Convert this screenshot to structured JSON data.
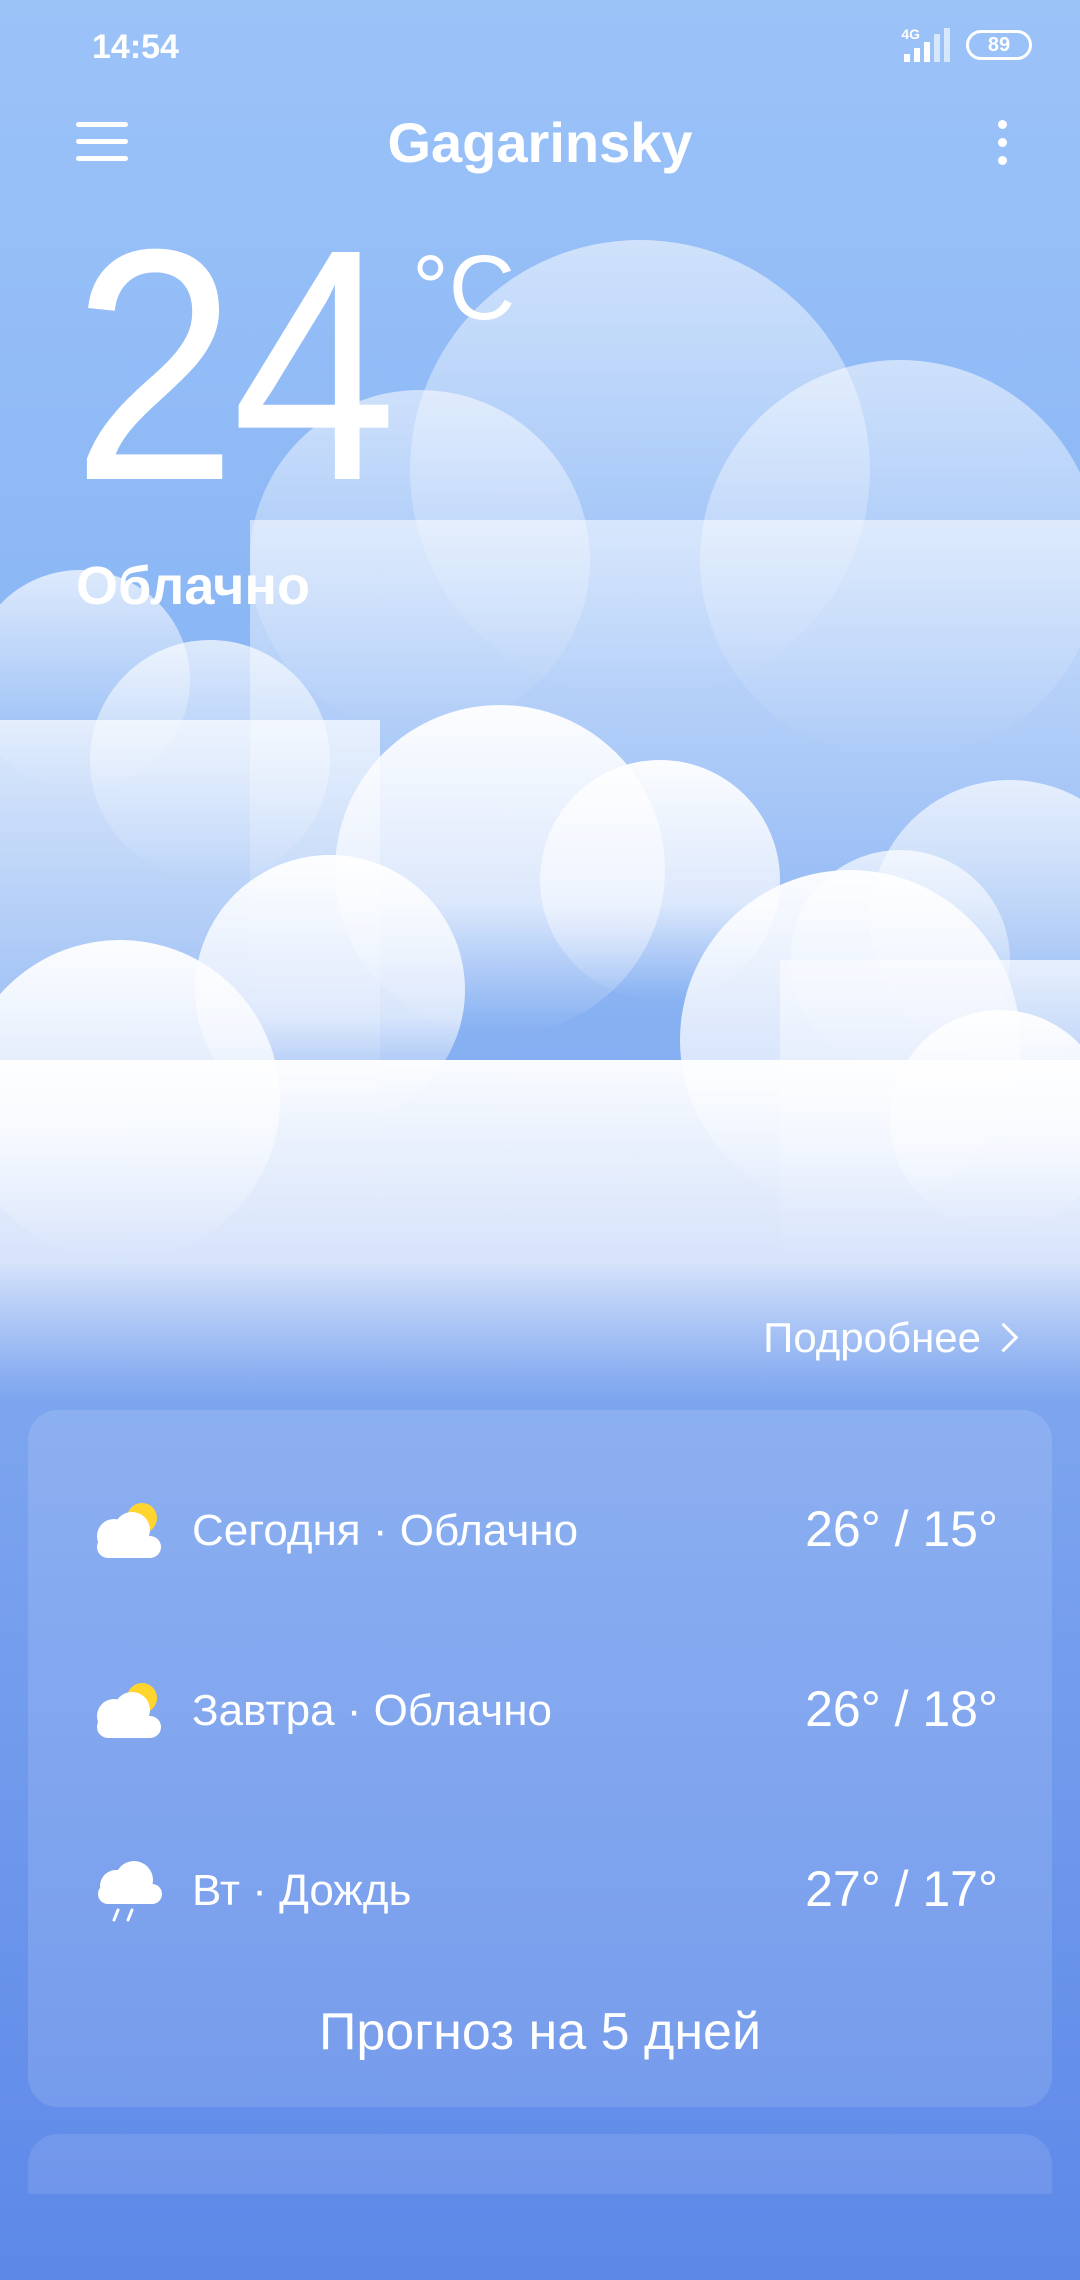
{
  "status_bar": {
    "time": "14:54",
    "network": "4G",
    "battery": "89"
  },
  "header": {
    "city": "Gagarinsky",
    "menu_icon": "hamburger-menu-icon",
    "more_icon": "more-vertical-icon"
  },
  "current": {
    "temperature": "24",
    "unit": "°C",
    "condition": "Облачно"
  },
  "details_link": "Подробнее",
  "forecast": {
    "rows": [
      {
        "icon": "partly-cloudy-icon",
        "label": "Сегодня · Облачно",
        "range": "26° / 15°"
      },
      {
        "icon": "partly-cloudy-icon",
        "label": "Завтра · Облачно",
        "range": "26° / 18°"
      },
      {
        "icon": "rain-cloud-icon",
        "label": "Вт · Дождь",
        "range": "27° / 17°"
      }
    ],
    "button_label": "Прогноз на 5 дней"
  },
  "colors": {
    "sky_top": "#9cc3f8",
    "sky_bottom": "#5d88e8",
    "sun": "#ffd52e"
  }
}
